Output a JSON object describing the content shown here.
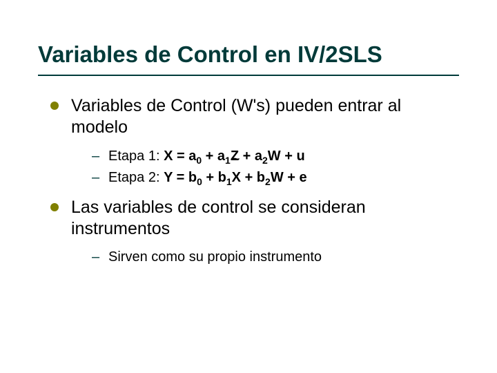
{
  "title": "Variables de Control en IV/2SLS",
  "bullets": [
    {
      "text": "Variables de Control (W's) pueden entrar al modelo",
      "sub": [
        {
          "label": "Etapa 1: ",
          "eq": "X = a0 + a1Z + a2W + u",
          "kind": "stage1"
        },
        {
          "label": "Etapa 2: ",
          "eq": "Y = b0 + b1X~ + b2W + e",
          "kind": "stage2"
        }
      ]
    },
    {
      "text": "Las variables de control se consideran instrumentos",
      "sub": [
        {
          "label": "",
          "eq": "Sirven como su propio instrumento",
          "kind": "plain"
        }
      ]
    }
  ]
}
